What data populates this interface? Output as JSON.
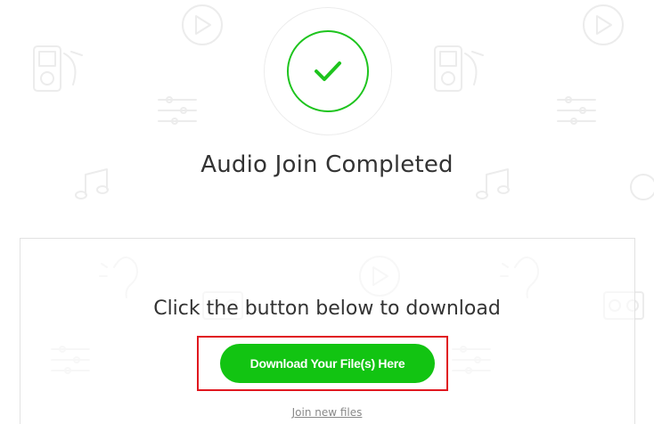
{
  "status": {
    "title": "Audio Join Completed",
    "icon": "check-circle-icon",
    "accent_color": "#1ec41e"
  },
  "download_panel": {
    "instruction": "Click the button below to download",
    "button_label": "Download Your File(s) Here",
    "button_color": "#12c412",
    "highlight_color": "#e0171f"
  },
  "footer": {
    "join_new_label": "Join new files"
  },
  "background": {
    "icons": [
      "play-icon",
      "mp3-player-icon",
      "sliders-icon",
      "music-note-icon",
      "ear-icon",
      "stereo-icon"
    ]
  }
}
